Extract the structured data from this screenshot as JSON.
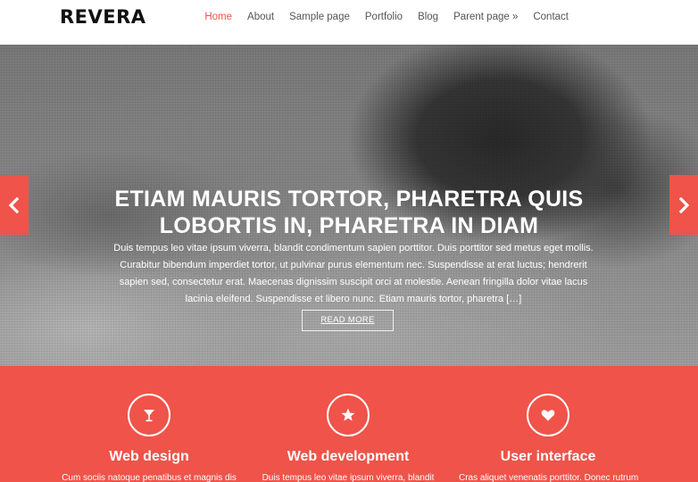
{
  "site": {
    "logo": "REVERA"
  },
  "nav": {
    "items": [
      {
        "label": "Home",
        "active": true
      },
      {
        "label": "About"
      },
      {
        "label": "Sample page"
      },
      {
        "label": "Portfolio"
      },
      {
        "label": "Blog"
      },
      {
        "label": "Parent page »"
      },
      {
        "label": "Contact"
      }
    ]
  },
  "slider": {
    "title_line1": "ETIAM MAURIS TORTOR, PHARETRA QUIS",
    "title_line2": "LOBORTIS IN, PHARETRA IN DIAM",
    "excerpt": "Duis tempus leo vitae ipsum viverra, blandit condimentum sapien porttitor. Duis porttitor sed metus eget mollis. Curabitur bibendum imperdiet tortor, ut pulvinar purus elementum nec. Suspendisse at erat luctus; hendrerit sapien sed, consectetur erat. Maecenas dignissim suscipit orci at molestie. Aenean fringilla dolor vitae lacus lacinia eleifend. Suspendisse et libero nunc. Etiam mauris tortor, pharetra […]",
    "button_label": "READ MORE",
    "prev_icon": "chevron-left-icon",
    "next_icon": "chevron-right-icon"
  },
  "features": [
    {
      "icon": "cocktail-glass-icon",
      "title": "Web design",
      "text": "Cum sociis natoque penatibus et magnis dis"
    },
    {
      "icon": "star-icon",
      "title": "Web development",
      "text": "Duis tempus leo vitae ipsum viverra, blandit"
    },
    {
      "icon": "heart-icon",
      "title": "User interface",
      "text": "Cras aliquet venenatis porttitor. Donec rutrum"
    }
  ],
  "colors": {
    "accent": "#ef5349",
    "text": "#555555",
    "logo": "#111111"
  }
}
